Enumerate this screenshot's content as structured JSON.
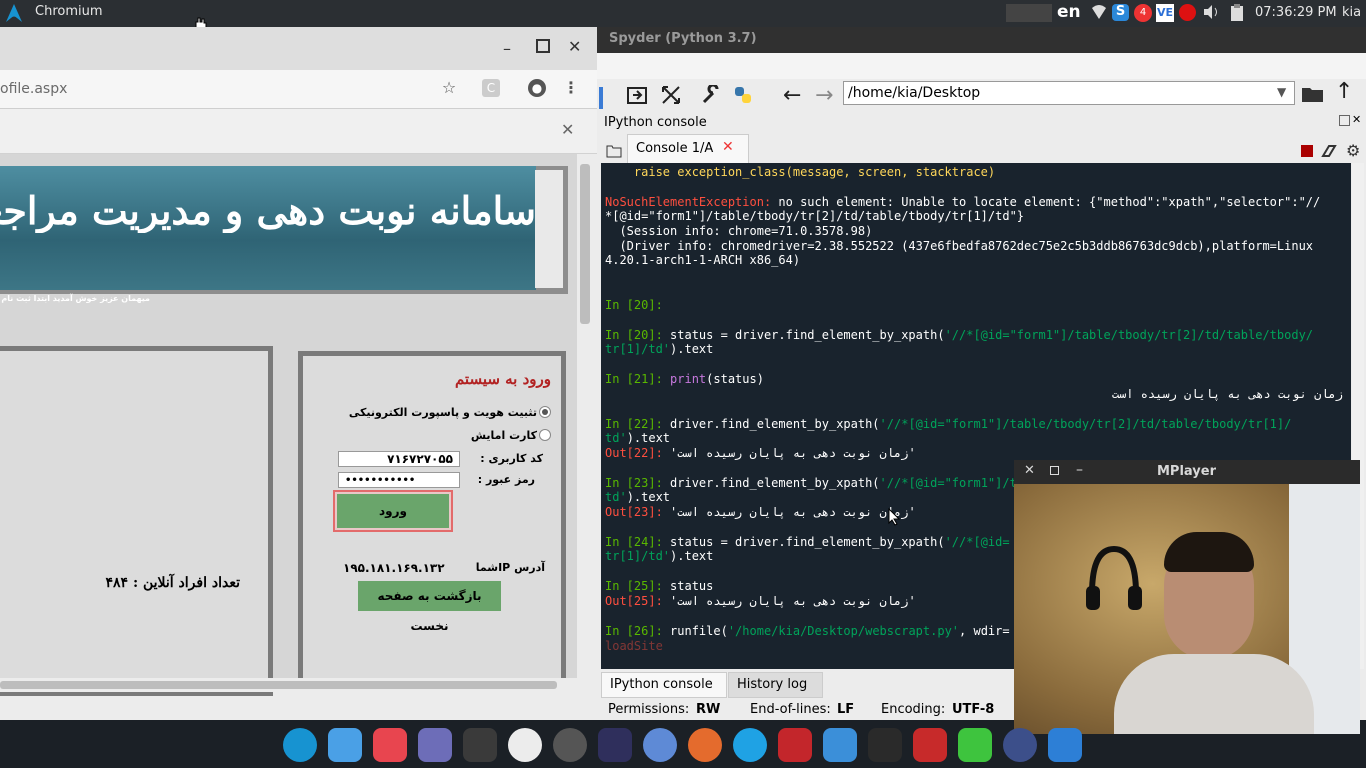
{
  "topbar": {
    "app_title": "Chromium",
    "language": "en",
    "notification_count": "4",
    "clock": "07:36:29 PM",
    "user": "kia"
  },
  "chromium": {
    "url": "ofile.aspx",
    "banner_text": "سامانه نوبت دهی و مدیریت مراجعات سفا",
    "welcome_text": "میهمان عزیز خوش آمدید ابتدا ثبت نام",
    "login": {
      "title": "ورود به سیستم",
      "option1": "تثبیت هویت و پاسپورت الکترونیکی",
      "option2": "کارت امایش",
      "username_label": "کد کاربری :",
      "username_value": "۷۱۶۷۲۷۰۵۵",
      "password_label": "رمز عبور :",
      "password_value": "•••••••••••",
      "login_button": "ورود",
      "ip_label": "آدرس IPشما",
      "ip_value": "۱۹۵.۱۸۱.۱۶۹.۱۳۲",
      "back_button": "بازگشت به صفحه نخست"
    },
    "online_count": "تعداد افراد آنلاین : ۴۸۴"
  },
  "spyder": {
    "title": "Spyder (Python 3.7)",
    "path": "/home/kia/Desktop",
    "pane_title": "IPython console",
    "console_tab": "Console 1/A",
    "bottom_tabs": [
      "IPython console",
      "History log"
    ],
    "status": {
      "permissions_label": "Permissions:",
      "permissions_value": "RW",
      "eol_label": "End-of-lines:",
      "eol_value": "LF",
      "encoding_label": "Encoding:",
      "encoding_value": "UTF-8"
    },
    "console": {
      "l1": "    raise exception_class(message, screen, stacktrace)",
      "l2a": "NoSuchElementException:",
      "l2b": " no such element: Unable to locate element: {\"method\":\"xpath\",\"selector\":\"//",
      "l3": "*[@id=\"form1\"]/table/tbody/tr[2]/td/table/tbody/tr[1]/td\"}",
      "l4": "  (Session info: chrome=71.0.3578.98)",
      "l5": "  (Driver info: chromedriver=2.38.552522 (437e6fbedfa8762dec75e2c5b3ddb86763dc9dcb),platform=Linux",
      "l6": "4.20.1-arch1-1-ARCH x86_64)",
      "in20": "In [20]:",
      "in20b_code": " status = driver.find_element_by_xpath(",
      "in20b_str": "'//*[@id=\"form1\"]/table/tbody/tr[2]/td/table/tbody/",
      "in20b_str2": "tr[1]/td'",
      "in20b_end": ").text",
      "in21": "In [21]:",
      "in21_kw": "print",
      "in21_code": "(status)",
      "out_text": "زمان نوبت دهی به پایان رسیده است",
      "in22": "In [22]:",
      "in22_code": " driver.find_element_by_xpath(",
      "in22_str": "'//*[@id=\"form1\"]/table/tbody/tr[2]/td/table/tbody/tr[1]/",
      "in22_str2": "td'",
      "in22_end": ").text",
      "out22": "Out[22]:",
      "out_val": " 'زمان نوبت دهی به پایان رسیده است'",
      "in23": "In [23]:",
      "in23_code": " driver.find_element_by_xpath(",
      "in23_str": "'//*[@id=\"form1\"]/t",
      "in23_str2": "td'",
      "in23_end": ").text",
      "out23": "Out[23]:",
      "in24": "In [24]:",
      "in24_code": " status = driver.find_element_by_xpath(",
      "in24_str": "'//*[@id=",
      "in24_str2": "tr[1]/td'",
      "in24_end": ").text",
      "in25": "In [25]:",
      "in25_code": " status",
      "out25": "Out[25]:",
      "in26": "In [26]:",
      "in26_code": " runfile(",
      "in26_str": "'/home/kia/Desktop/webscrapt.py'",
      "in26_end": ", wdir=",
      "loadsite": "loadSite"
    }
  },
  "mplayer": {
    "title": "MPlayer"
  },
  "colors": {
    "console_bg": "#19232d",
    "prompt_green": "#59b800",
    "error_red": "#ff4f3f",
    "string_green": "#00a35a"
  }
}
